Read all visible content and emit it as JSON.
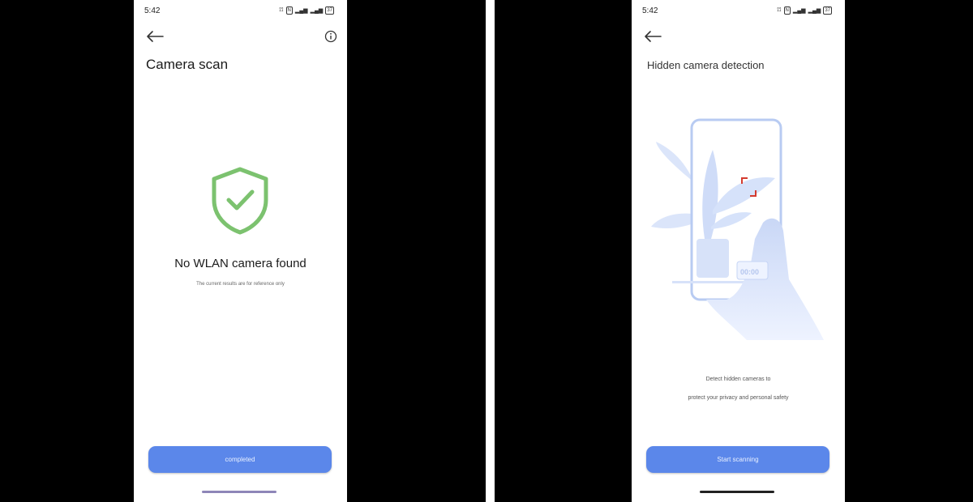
{
  "left_screen": {
    "status": {
      "time": "5:42",
      "battery": "37"
    },
    "title": "Camera scan",
    "result_text": "No WLAN camera found",
    "note": "The current results are for reference only",
    "button_label": "completed",
    "accent_color": "#5b87ea",
    "shield_color": "#7cc26f",
    "icons": [
      "back-arrow-icon",
      "info-icon",
      "shield-check-icon"
    ]
  },
  "right_screen": {
    "status": {
      "time": "5:42",
      "battery": "37"
    },
    "title": "Hidden camera detection",
    "description_line1": "Detect hidden cameras to",
    "description_line2": "protect your privacy and personal safety",
    "illustration_label": "00:00",
    "button_label": "Start scanning",
    "accent_color": "#5b87ea",
    "icons": [
      "back-arrow-icon",
      "phone-scan-illustration"
    ]
  }
}
